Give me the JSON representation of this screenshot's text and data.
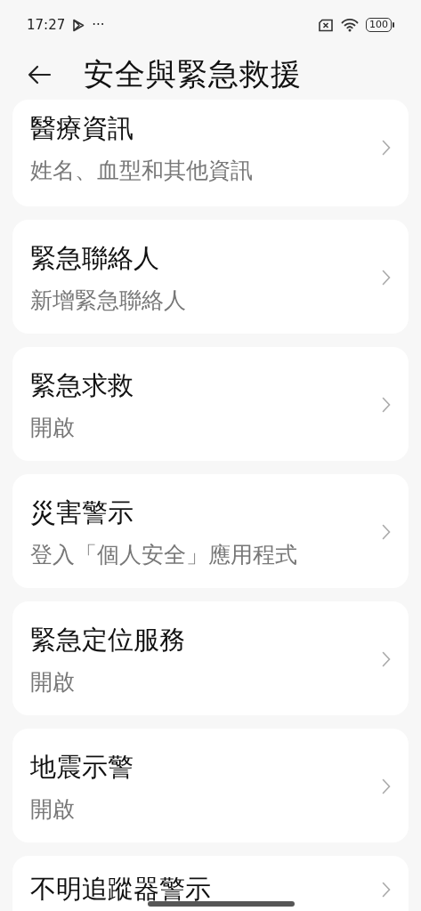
{
  "status_bar": {
    "time": "17:27",
    "more": "···",
    "battery": "100"
  },
  "header": {
    "title": "安全與緊急救援"
  },
  "items": [
    {
      "title": "醫療資訊",
      "subtitle": "姓名、血型和其他資訊"
    },
    {
      "title": "緊急聯絡人",
      "subtitle": "新增緊急聯絡人"
    },
    {
      "title": "緊急求救",
      "subtitle": "開啟"
    },
    {
      "title": "災害警示",
      "subtitle": "登入「個人安全」應用程式"
    },
    {
      "title": "緊急定位服務",
      "subtitle": "開啟"
    },
    {
      "title": "地震示警",
      "subtitle": "開啟"
    },
    {
      "title": "不明追蹤器警示"
    }
  ]
}
